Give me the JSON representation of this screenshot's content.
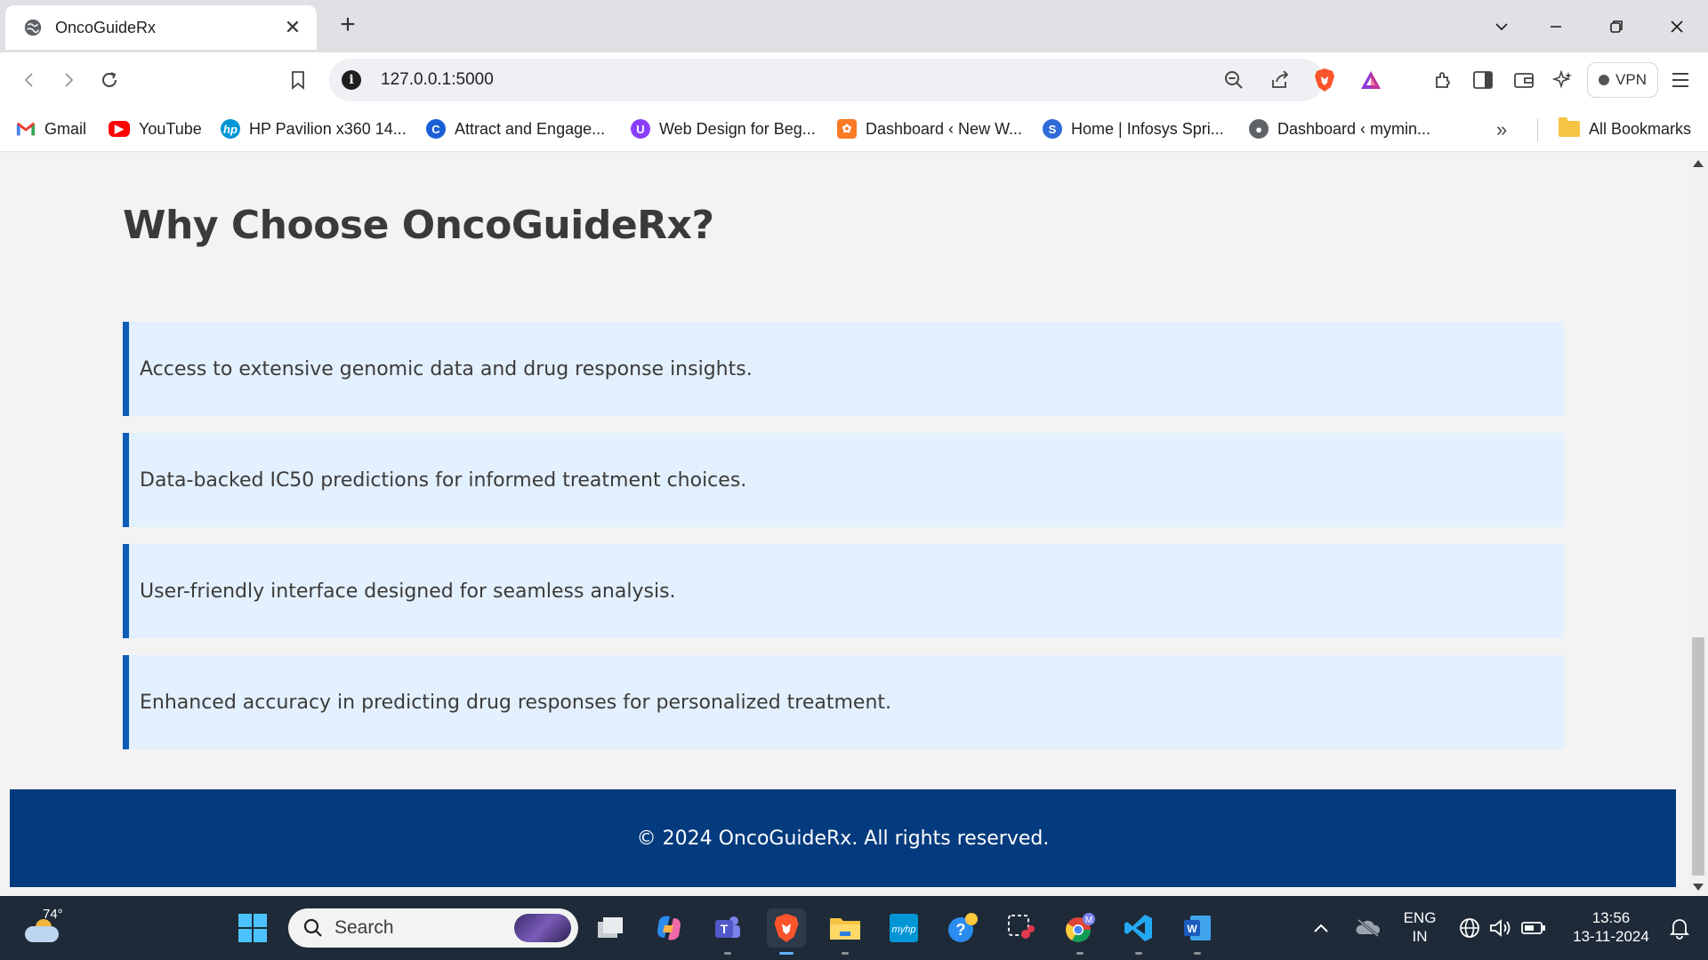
{
  "browser": {
    "tab_title": "OncoGuideRx",
    "url": "127.0.0.1:5000",
    "vpn_label": "VPN",
    "bookmarks": [
      {
        "label": "Gmail",
        "icon": "gmail-icon"
      },
      {
        "label": "YouTube",
        "icon": "youtube-icon"
      },
      {
        "label": "HP Pavilion x360 14...",
        "icon": "hp-icon"
      },
      {
        "label": "Attract and Engage...",
        "icon": "c-logo-icon"
      },
      {
        "label": "Web Design for Beg...",
        "icon": "purple-logo-icon"
      },
      {
        "label": "Dashboard ‹ New W...",
        "icon": "xampp-icon"
      },
      {
        "label": "Home | Infosys Spri...",
        "icon": "springboard-icon"
      },
      {
        "label": "Dashboard ‹ mymin...",
        "icon": "globe-icon"
      }
    ],
    "all_bookmarks_label": "All Bookmarks"
  },
  "page": {
    "section_title": "Why Choose OncoGuideRx?",
    "features": [
      "Access to extensive genomic data and drug response insights.",
      "Data-backed IC50 predictions for informed treatment choices.",
      "User-friendly interface designed for seamless analysis.",
      "Enhanced accuracy in predicting drug responses for personalized treatment."
    ],
    "footer_text": "© 2024 OncoGuideRx. All rights reserved."
  },
  "taskbar": {
    "weather_temp": "74°",
    "search_label": "Search",
    "language": "ENG",
    "region": "IN",
    "time": "13:56",
    "date": "13-11-2024"
  },
  "colors": {
    "feature_bg": "#e3f0fd",
    "feature_accent": "#0d5cb5",
    "footer_bg": "#043b7e",
    "page_bg": "#f3f3f3"
  }
}
